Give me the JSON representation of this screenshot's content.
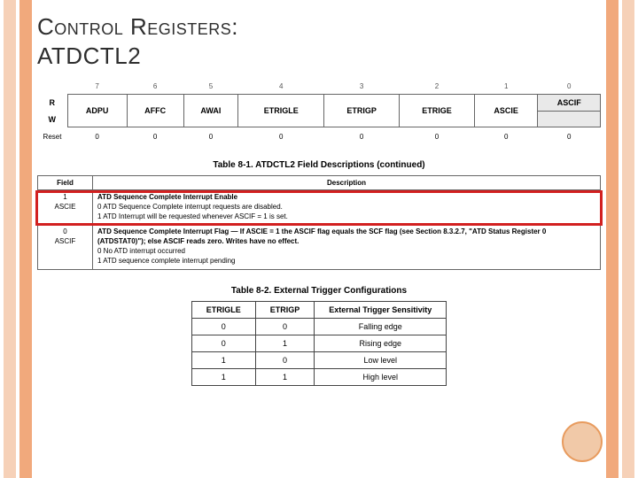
{
  "title_line1": "Control Registers:",
  "title_line2": "ATDCTL2",
  "bit_table": {
    "numbers": [
      "7",
      "6",
      "5",
      "4",
      "3",
      "2",
      "1",
      "0"
    ],
    "row_r_head": "R",
    "row_r": [
      "ADPU",
      "AFFC",
      "AWAI",
      "ETRIGLE",
      "ETRIGP",
      "ETRIGE",
      "ASCIE",
      ""
    ],
    "row_w_head": "W",
    "ascif_label": "ASCIF",
    "reset_head": "Reset",
    "reset_vals": [
      "0",
      "0",
      "0",
      "0",
      "0",
      "0",
      "0",
      "0"
    ]
  },
  "caption1": "Table 8-1. ATDCTL2 Field Descriptions (continued)",
  "desc_table": {
    "head_field": "Field",
    "head_desc": "Description",
    "row1": {
      "bit": "1",
      "name": "ASCIE",
      "l1": "ATD Sequence Complete Interrupt Enable",
      "l2": "0  ATD Sequence Complete interrupt requests are disabled.",
      "l3": "1  ATD Interrupt will be requested whenever ASCIF = 1 is set."
    },
    "row2": {
      "bit": "0",
      "name": "ASCIF",
      "l1": "ATD Sequence Complete Interrupt Flag — If ASCIE = 1 the ASCIF flag equals the SCF flag (see Section 8.3.2.7, \"ATD Status Register 0 (ATDSTAT0)\"); else ASCIF reads zero. Writes have no effect.",
      "l2": "0  No ATD interrupt occurred",
      "l3": "1  ATD sequence complete interrupt pending"
    }
  },
  "caption2": "Table 8-2. External Trigger Configurations",
  "trig_table": {
    "h1": "ETRIGLE",
    "h2": "ETRIGP",
    "h3": "External Trigger Sensitivity",
    "rows": [
      [
        "0",
        "0",
        "Falling edge"
      ],
      [
        "0",
        "1",
        "Rising edge"
      ],
      [
        "1",
        "0",
        "Low level"
      ],
      [
        "1",
        "1",
        "High level"
      ]
    ]
  }
}
